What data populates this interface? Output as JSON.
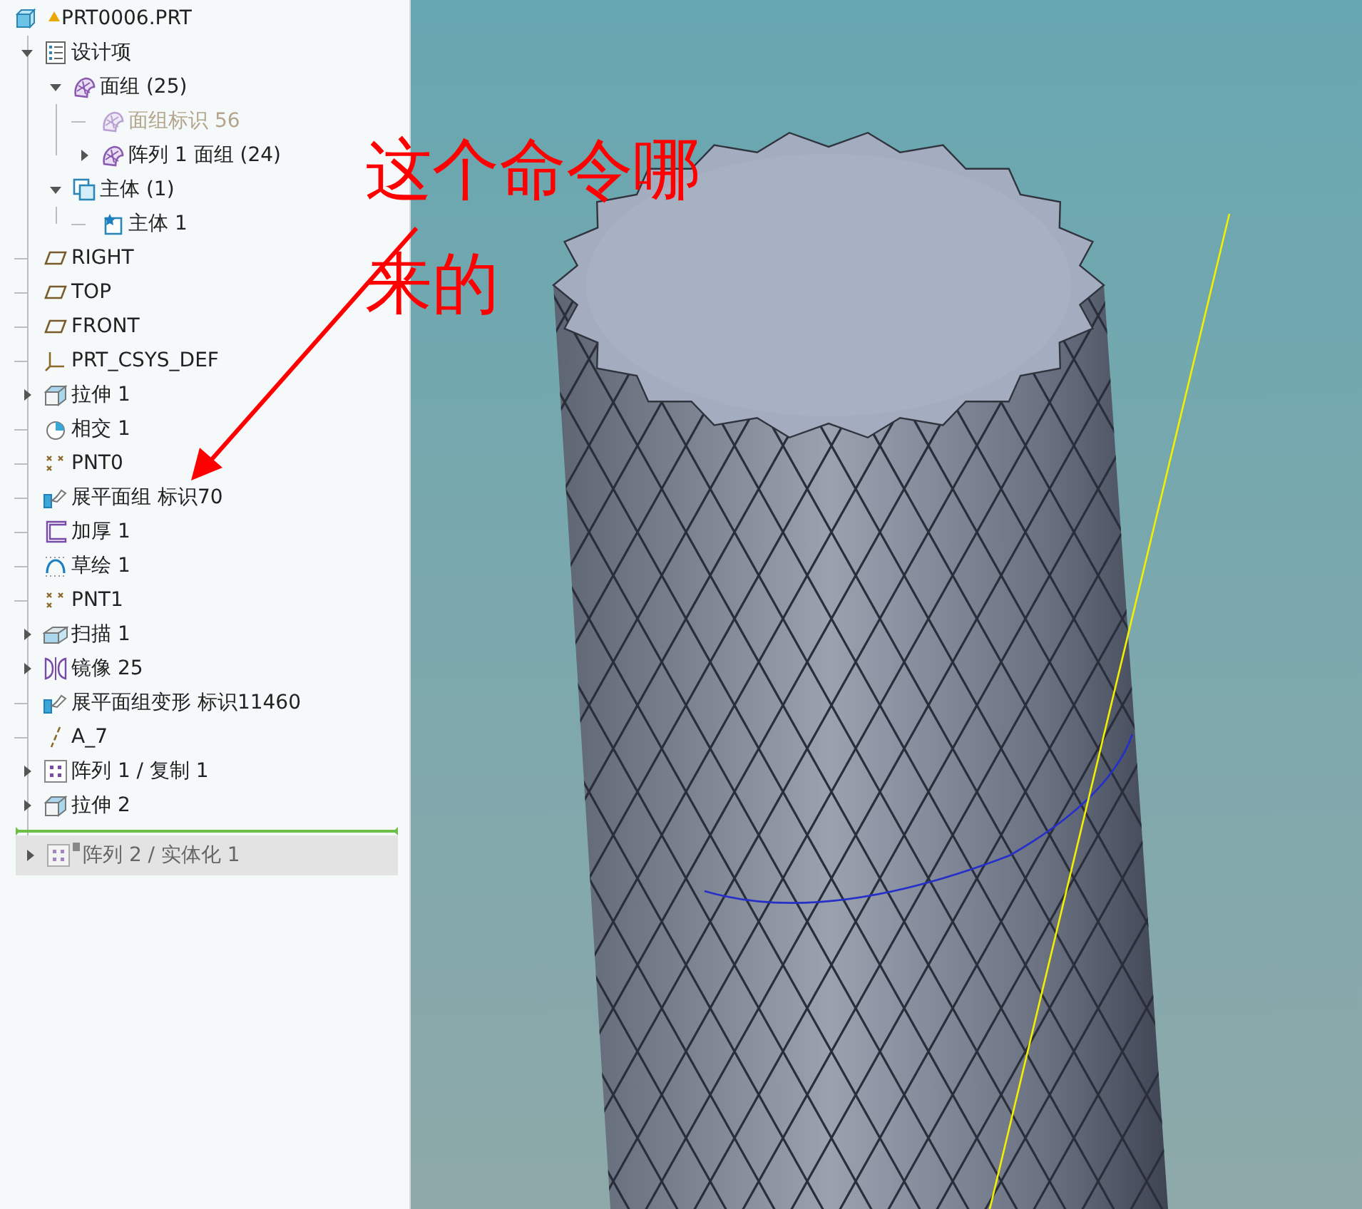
{
  "tree": {
    "root": {
      "label": "PRT0006.PRT",
      "warning": true
    },
    "items": [
      {
        "label": "设计项",
        "kind": "design-items",
        "expanded": true,
        "dimmed": false,
        "children": [
          {
            "label": "面组 (25)",
            "kind": "quilt",
            "expanded": true,
            "dimmed": false,
            "children": [
              {
                "label": "面组标识 56",
                "kind": "quilt",
                "dimmed": true
              },
              {
                "label": "阵列 1 面组 (24)",
                "kind": "quilt",
                "expanded": false,
                "dimmed": false
              }
            ]
          },
          {
            "label": "主体 (1)",
            "kind": "bodies",
            "expanded": true,
            "dimmed": false,
            "children": [
              {
                "label": "主体 1",
                "kind": "body",
                "dimmed": false
              }
            ]
          }
        ]
      },
      {
        "label": "RIGHT",
        "kind": "plane",
        "dimmed": false
      },
      {
        "label": "TOP",
        "kind": "plane",
        "dimmed": false
      },
      {
        "label": "FRONT",
        "kind": "plane",
        "dimmed": false
      },
      {
        "label": "PRT_CSYS_DEF",
        "kind": "csys",
        "dimmed": false
      },
      {
        "label": "拉伸 1",
        "kind": "extrude",
        "expanded": false,
        "dimmed": false
      },
      {
        "label": "相交 1",
        "kind": "intersect",
        "dimmed": false
      },
      {
        "label": "PNT0",
        "kind": "point",
        "dimmed": false
      },
      {
        "label": "展平面组 标识70",
        "kind": "flatten",
        "dimmed": false
      },
      {
        "label": "加厚 1",
        "kind": "thicken",
        "dimmed": false
      },
      {
        "label": "草绘 1",
        "kind": "sketch",
        "dimmed": false
      },
      {
        "label": "PNT1",
        "kind": "point",
        "dimmed": false
      },
      {
        "label": "扫描 1",
        "kind": "sweep",
        "expanded": false,
        "dimmed": false
      },
      {
        "label": "镜像 25",
        "kind": "mirror",
        "expanded": false,
        "dimmed": false
      },
      {
        "label": "展平面组变形 标识11460",
        "kind": "flatten",
        "dimmed": false
      },
      {
        "label": "A_7",
        "kind": "axis",
        "dimmed": false
      },
      {
        "label": "阵列 1 / 复制 1",
        "kind": "pattern",
        "expanded": false,
        "dimmed": false
      },
      {
        "label": "拉伸 2",
        "kind": "extrude",
        "expanded": false,
        "dimmed": false
      },
      {
        "kind": "insert-line"
      },
      {
        "label": "阵列 2 / 实体化 1",
        "kind": "pattern",
        "expanded": false,
        "dimmed": true
      }
    ]
  },
  "viewport": {
    "annotation": {
      "text": "这个命令哪来的"
    }
  }
}
